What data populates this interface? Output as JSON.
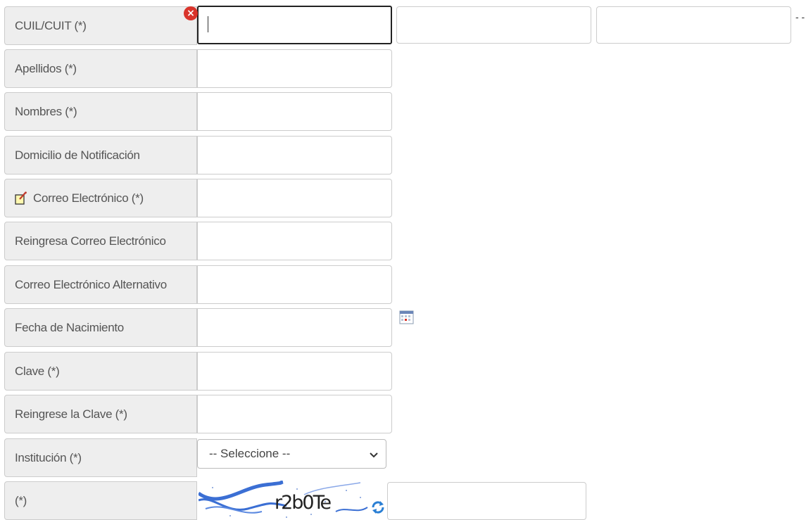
{
  "form": {
    "rows": [
      {
        "label": "CUIL/CUIT (*)",
        "value": ""
      },
      {
        "label": "Apellidos (*)",
        "value": ""
      },
      {
        "label": "Nombres (*)",
        "value": ""
      },
      {
        "label": "Domicilio de Notificación",
        "value": ""
      },
      {
        "label": "Correo Electrónico (*)",
        "value": ""
      },
      {
        "label": "Reingresa Correo Electrónico",
        "value": ""
      },
      {
        "label": "Correo Electrónico Alternativo",
        "value": ""
      },
      {
        "label": "Fecha de Nacimiento",
        "value": ""
      },
      {
        "label": "Clave (*)",
        "value": ""
      },
      {
        "label": "Reingrese la Clave (*)",
        "value": ""
      },
      {
        "label": "Institución (*)",
        "value": ""
      },
      {
        "label": "(*)",
        "value": ""
      }
    ],
    "institucion_selected": "-- Seleccione --",
    "captcha_text": "r2b0Te",
    "trailing_text": "- -"
  },
  "icons": {
    "error": "error-x-icon",
    "edit": "edit-note-icon",
    "calendar": "calendar-icon",
    "chevron": "chevron-down-icon",
    "refresh": "refresh-icon"
  },
  "colors": {
    "label_bg": "#eeeeee",
    "border": "#cccccc",
    "error": "#d9342b",
    "refresh": "#2a7fd4"
  }
}
